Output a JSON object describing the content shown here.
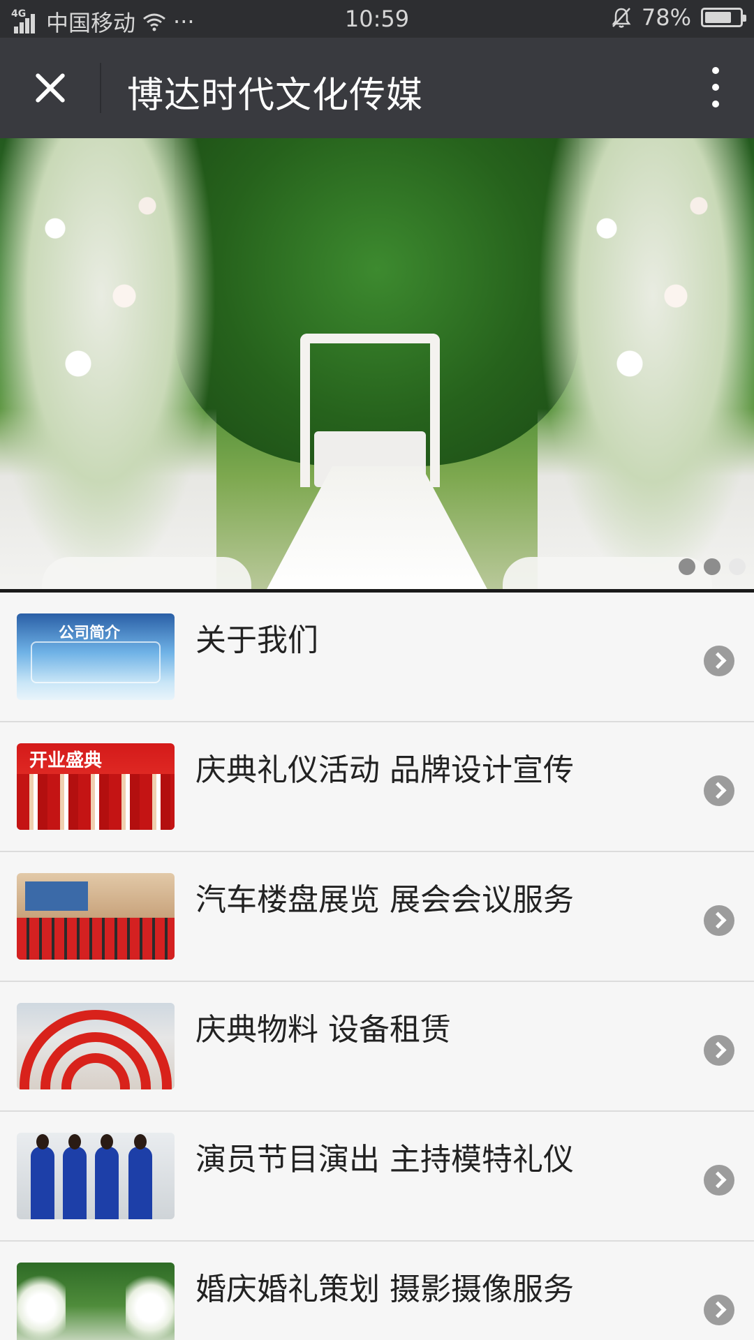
{
  "status_bar": {
    "network_type": "4G",
    "carrier": "中国移动",
    "more_dots": "···",
    "time": "10:59",
    "battery_text": "78%",
    "battery_level": 0.78
  },
  "title_bar": {
    "title": "博达时代文化传媒"
  },
  "banner": {
    "slide_count": 3,
    "active_index": 2
  },
  "list": {
    "items": [
      {
        "label": "关于我们",
        "thumb_text": "公司简介",
        "icon": "chevron-right-icon"
      },
      {
        "label": "庆典礼仪活动 品牌设计宣传",
        "thumb_text": "开业盛典",
        "icon": "chevron-right-icon"
      },
      {
        "label": "汽车楼盘展览 展会会议服务",
        "thumb_text": "",
        "icon": "chevron-right-icon"
      },
      {
        "label": "庆典物料 设备租赁",
        "thumb_text": "",
        "icon": "chevron-right-icon"
      },
      {
        "label": "演员节目演出 主持模特礼仪",
        "thumb_text": "",
        "icon": "chevron-right-icon"
      },
      {
        "label": "婚庆婚礼策划 摄影摄像服务",
        "thumb_text": "",
        "icon": "chevron-right-icon"
      }
    ]
  }
}
